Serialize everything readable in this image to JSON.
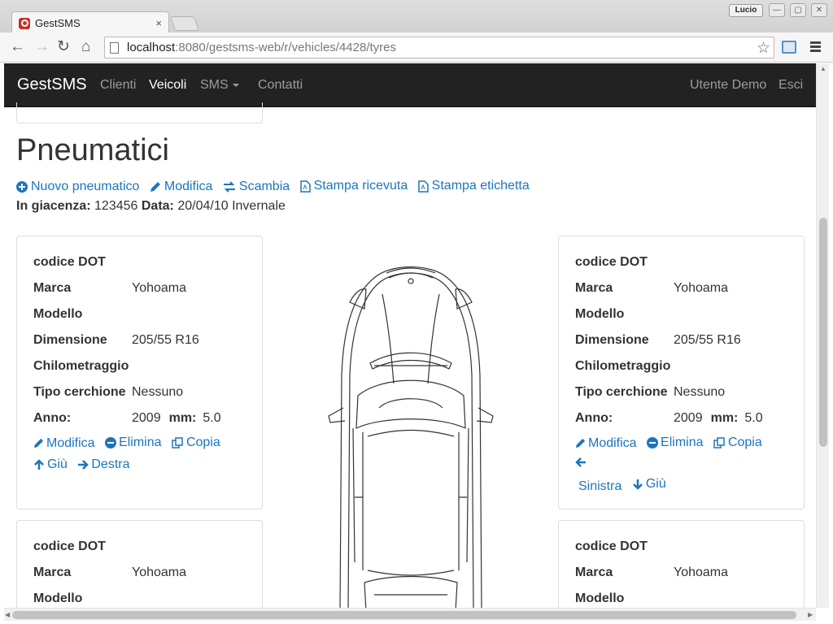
{
  "browser": {
    "tab_title": "GestSMS",
    "tab_close": "×",
    "profile_name": "Lucio",
    "url_host": "localhost",
    "url_rest": ":8080/gestsms-web/r/vehicles/4428/tyres"
  },
  "navbar": {
    "brand": "GestSMS",
    "links": [
      "Clienti",
      "Veicoli",
      "SMS",
      "Contatti"
    ],
    "user": "Utente Demo",
    "logout": "Esci"
  },
  "page": {
    "title": "Pneumatici",
    "actions": [
      "Nuovo pneumatico",
      "Modifica",
      "Scambia",
      "Stampa ricevuta",
      "Stampa etichetta"
    ],
    "stock_label": "In giacenza:",
    "stock_value": "123456",
    "date_label": "Data:",
    "date_value": "20/04/10 Invernale"
  },
  "tyre_labels": {
    "dot": "codice DOT",
    "brand": "Marca",
    "model": "Modello",
    "size": "Dimensione",
    "km": "Chilometraggio",
    "rim": "Tipo cerchione",
    "year": "Anno:",
    "mm": "mm:"
  },
  "tyres": [
    {
      "brand": "Yohoama",
      "size": "205/55 R16",
      "rim": "Nessuno",
      "year": "2009",
      "mm": "5.0",
      "links": [
        "Modifica",
        "Elimina",
        "Copia",
        "Giù",
        "Destra"
      ]
    },
    {
      "brand": "Yohoama",
      "size": "205/55 R16",
      "rim": "Nessuno",
      "year": "2009",
      "mm": "5.0",
      "links": [
        "Modifica",
        "Elimina",
        "Copia",
        "Sinistra",
        "Giù"
      ]
    },
    {
      "brand": "Yohoama"
    },
    {
      "brand": "Yohoama"
    }
  ],
  "colors": {
    "navbar": "#222222",
    "link": "#1c75bc",
    "nav_text": "#9d9d9d"
  }
}
